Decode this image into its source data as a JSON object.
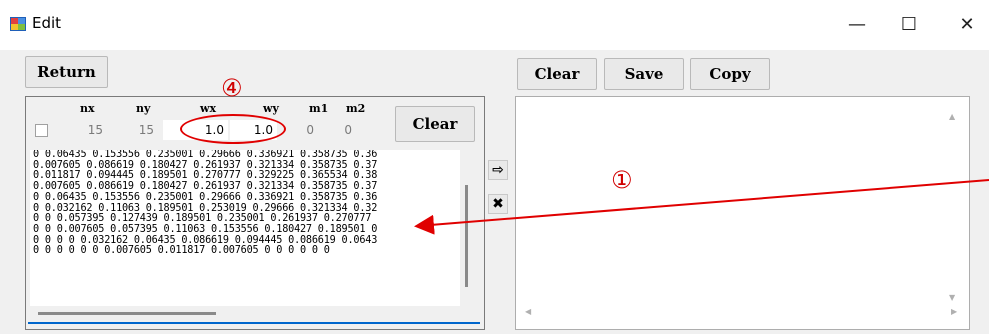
{
  "window": {
    "title": "Edit",
    "minimize": "—",
    "maximize": "☐",
    "close": "✕"
  },
  "toolbar": {
    "return_label": "Return",
    "clear_label": "Clear",
    "save_label": "Save",
    "copy_label": "Copy"
  },
  "params": {
    "headers": {
      "nx": "nx",
      "ny": "ny",
      "wx": "wx",
      "wy": "wy",
      "m1": "m1",
      "m2": "m2"
    },
    "values": {
      "nx": "15",
      "ny": "15",
      "wx": "1.0",
      "wy": "1.0",
      "m1": "0",
      "m2": "0"
    },
    "clear_label": "Clear",
    "checked": false
  },
  "data_lines": [
    "0 0.06435 0.153556 0.235001 0.29666 0.336921 0.358735 0.36",
    "0.007605 0.086619 0.180427 0.261937 0.321334 0.358735 0.37",
    "0.011817 0.094445 0.189501 0.270777 0.329225 0.365534 0.38",
    "0.007605 0.086619 0.180427 0.261937 0.321334 0.358735 0.37",
    "0 0.06435 0.153556 0.235001 0.29666 0.336921 0.358735 0.36",
    "0 0.032162 0.11063 0.189501 0.253019 0.29666 0.321334 0.32",
    "0 0 0.057395 0.127439 0.189501 0.235001 0.261937 0.270777",
    "0 0 0.007605 0.057395 0.11063 0.153556 0.180427 0.189501 0",
    "0 0 0 0 0.032162 0.06435 0.086619 0.094445 0.086619 0.0643",
    "0 0 0 0 0 0 0.007605 0.011817 0.007605 0 0 0 0 0 0"
  ],
  "side_buttons": {
    "transfer_glyph": "⇨",
    "delete_glyph": "✖"
  },
  "scroll_glyphs": {
    "up": "▲",
    "down": "▼",
    "left": "◀",
    "right": "▶"
  },
  "annotations": {
    "circled_1": "①",
    "circled_4": "④",
    "color": "#e00000"
  }
}
